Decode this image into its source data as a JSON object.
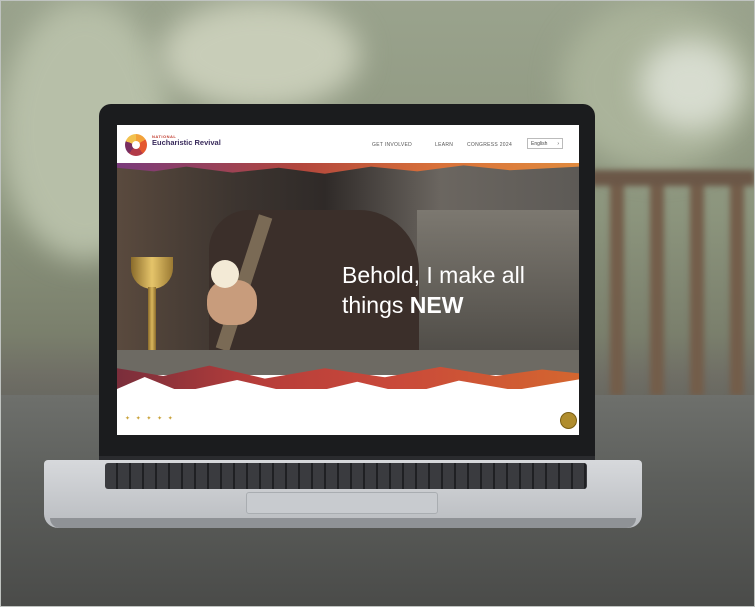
{
  "site": {
    "logo_small": "NATIONAL",
    "logo_name": "Eucharistic Revival",
    "nav": [
      "GET INVOLVED",
      "LEARN",
      "CONGRESS 2024"
    ],
    "language": "English",
    "hero_title_line1": "Behold, I make all",
    "hero_title_line2": "things",
    "hero_title_emphasis": "NEW"
  },
  "colors": {
    "brand_purple": "#3a2b5c",
    "brand_red": "#c0392b",
    "accent_orange": "#d9723a"
  },
  "icons": [
    "revival-logo-icon",
    "chevron-down-icon",
    "gold-seal-icon"
  ]
}
